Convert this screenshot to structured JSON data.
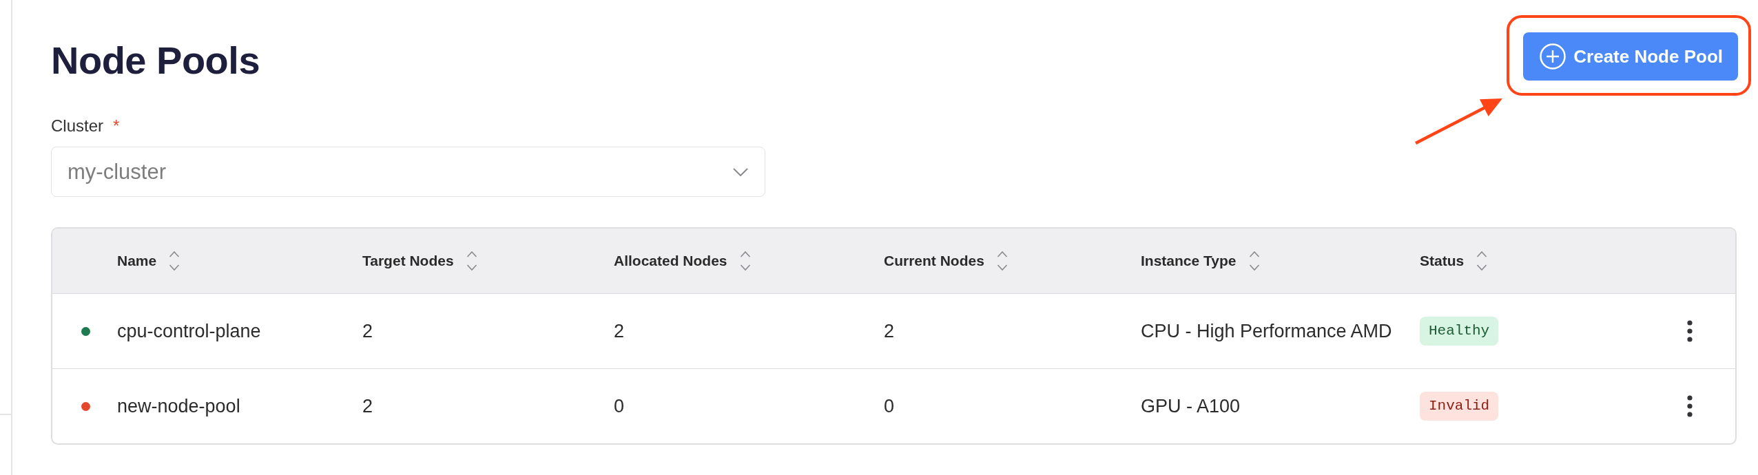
{
  "page": {
    "title": "Node Pools"
  },
  "create_button": {
    "label": "Create Node Pool"
  },
  "cluster_field": {
    "label": "Cluster",
    "required_mark": "*",
    "value": "my-cluster"
  },
  "table": {
    "columns": [
      "Name",
      "Target Nodes",
      "Allocated Nodes",
      "Current Nodes",
      "Instance Type",
      "Status"
    ],
    "rows": [
      {
        "color": "#1f7a50",
        "name": "cpu-control-plane",
        "target_nodes": "2",
        "allocated_nodes": "2",
        "current_nodes": "2",
        "instance_type": "CPU - High Performance AMD",
        "status": {
          "label": "Healthy",
          "kind": "healthy"
        }
      },
      {
        "color": "#e5472d",
        "name": "new-node-pool",
        "target_nodes": "2",
        "allocated_nodes": "0",
        "current_nodes": "0",
        "instance_type": "GPU - A100",
        "status": {
          "label": "Invalid",
          "kind": "invalid"
        }
      }
    ]
  },
  "annotation": {
    "kind": "highlight_with_arrow"
  }
}
